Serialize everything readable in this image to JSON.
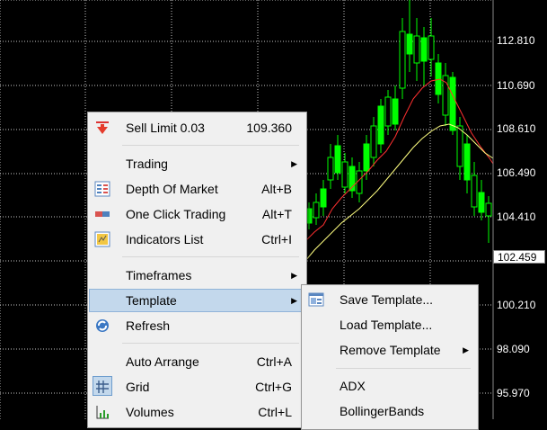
{
  "price_axis": {
    "labels": [
      "112.810",
      "110.690",
      "108.610",
      "106.490",
      "104.410",
      "102.459",
      "100.210",
      "98.090",
      "95.970"
    ],
    "current_price": "102.459"
  },
  "context_menu": {
    "items": [
      {
        "label": "Sell Limit 0.03",
        "shortcut": "109.360",
        "icon": "sell-limit-arrow-icon"
      },
      {
        "label": "Trading",
        "icon": ""
      },
      {
        "label": "Depth Of Market",
        "shortcut": "Alt+B",
        "icon": "depth-of-market-icon"
      },
      {
        "label": "One Click Trading",
        "shortcut": "Alt+T",
        "icon": "one-click-trading-icon"
      },
      {
        "label": "Indicators List",
        "shortcut": "Ctrl+I",
        "icon": "indicators-list-icon"
      },
      {
        "label": "Timeframes",
        "icon": ""
      },
      {
        "label": "Template",
        "icon": ""
      },
      {
        "label": "Refresh",
        "icon": "refresh-icon"
      },
      {
        "label": "Auto Arrange",
        "shortcut": "Ctrl+A",
        "icon": ""
      },
      {
        "label": "Grid",
        "shortcut": "Ctrl+G",
        "icon": "grid-icon"
      },
      {
        "label": "Volumes",
        "shortcut": "Ctrl+L",
        "icon": "volumes-icon"
      }
    ]
  },
  "template_submenu": {
    "items": [
      {
        "label": "Save Template...",
        "icon": "save-template-icon"
      },
      {
        "label": "Load Template..."
      },
      {
        "label": "Remove Template"
      },
      {
        "label": "ADX"
      },
      {
        "label": "BollingerBands"
      }
    ]
  },
  "colors": {
    "chart_background": "#000000",
    "candle": "#00ff00",
    "grid": "#c8c8c8",
    "ma_fast": "#ff3030",
    "ma_slow": "#ffff80",
    "highlight": "#c3d8ec"
  }
}
